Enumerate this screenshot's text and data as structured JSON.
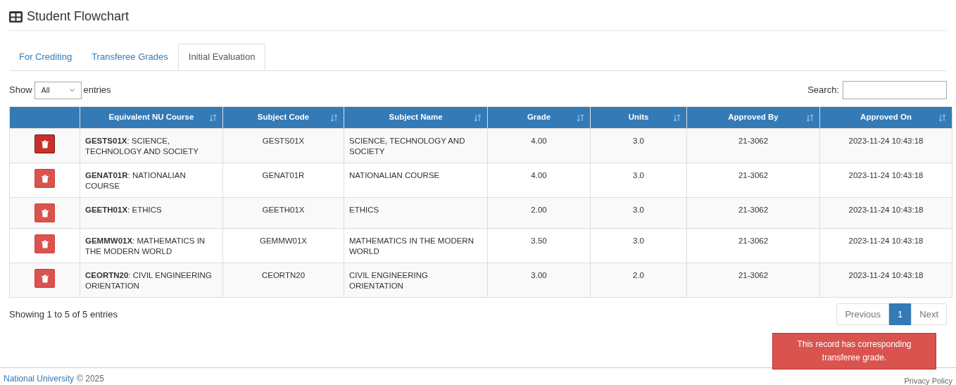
{
  "page": {
    "title": "Student Flowchart"
  },
  "tabs": [
    {
      "label": "For Crediting",
      "selected": false
    },
    {
      "label": "Transferee Grades",
      "selected": false
    },
    {
      "label": "Initial Evaluation",
      "selected": true
    }
  ],
  "length_control": {
    "label_before": "Show",
    "value": "All",
    "label_after": "entries"
  },
  "search": {
    "label": "Search:"
  },
  "table": {
    "columns": [
      "",
      "Equivalent NU Course",
      "Subject Code",
      "Subject Name",
      "Grade",
      "Units",
      "Approved By",
      "Approved On"
    ],
    "rows": [
      {
        "delete_active": true,
        "course": "**GESTS01X**: SCIENCE, TECHNOLOGY AND SOCIETY",
        "code": "GESTS01X",
        "name": "SCIENCE, TECHNOLOGY AND SOCIETY",
        "grade": "4.00",
        "units": "3.0",
        "approved_by": "21-3062",
        "approved_on": "2023-11-24 10:43:18"
      },
      {
        "delete_active": false,
        "course": "**GENAT01R**: NATIONALIAN COURSE",
        "code": "GENAT01R",
        "name": "NATIONALIAN COURSE",
        "grade": "4.00",
        "units": "3.0",
        "approved_by": "21-3062",
        "approved_on": "2023-11-24 10:43:18"
      },
      {
        "delete_active": false,
        "course": "**GEETH01X**: ETHICS",
        "code": "GEETH01X",
        "name": "ETHICS",
        "grade": "2.00",
        "units": "3.0",
        "approved_by": "21-3062",
        "approved_on": "2023-11-24 10:43:18"
      },
      {
        "delete_active": false,
        "course": "**GEMMW01X**: MATHEMATICS IN THE MODERN WORLD",
        "code": "GEMMW01X",
        "name": "MATHEMATICS IN THE MODERN WORLD",
        "grade": "3.50",
        "units": "3.0",
        "approved_by": "21-3062",
        "approved_on": "2023-11-24 10:43:18"
      },
      {
        "delete_active": false,
        "course": "**CEORTN20**: CIVIL ENGINEERING ORIENTATION",
        "code": "CEORTN20",
        "name": "CIVIL ENGINEERING ORIENTATION",
        "grade": "3.00",
        "units": "2.0",
        "approved_by": "21-3062",
        "approved_on": "2023-11-24 10:43:18"
      }
    ]
  },
  "info": "Showing 1 to 5 of 5 entries",
  "pagination": [
    {
      "label": "Previous",
      "selected": false
    },
    {
      "label": "1",
      "selected": true
    },
    {
      "label": "Next",
      "selected": false
    }
  ],
  "toast": "This record has corresponding transferee grade.",
  "footer": {
    "org": "National University",
    "copyright": "© 2025",
    "link": "Privacy Policy"
  }
}
